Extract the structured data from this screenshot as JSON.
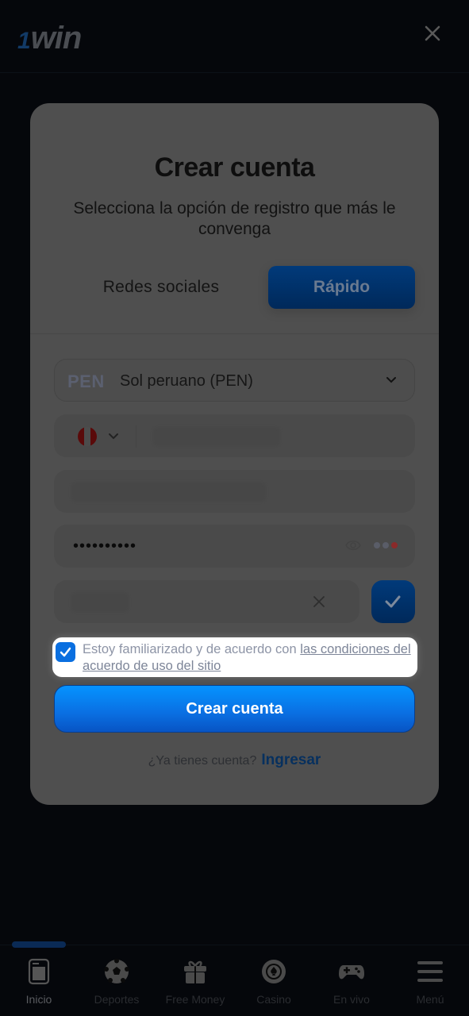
{
  "header": {
    "logo_one": "1",
    "logo_text": "win",
    "close_icon": "close-icon"
  },
  "modal": {
    "title": "Crear cuenta",
    "subtitle": "Selecciona la opción de registro que más le convenga",
    "tabs": [
      {
        "label": "Redes sociales",
        "active": false
      },
      {
        "label": "Rápido",
        "active": true
      }
    ],
    "currency": {
      "code": "PEN",
      "name": "Sol peruano (PEN)"
    },
    "phone": {
      "country_flag": "peru-flag",
      "value_obscured": true
    },
    "email": {
      "value_obscured": true
    },
    "password": {
      "masked_value": "••••••••••",
      "strength": {
        "level": 1,
        "max": 3
      }
    },
    "promo": {
      "value_obscured": true
    },
    "terms": {
      "checked": true,
      "text_prefix": "Estoy familiarizado y de acuerdo con ",
      "link_text": "las condiciones del acuerdo de uso del sitio"
    },
    "submit_label": "Crear cuenta",
    "login_prompt": "¿Ya tienes cuenta?",
    "login_link": "Ingresar"
  },
  "colors": {
    "accent": "#0a6fe0",
    "overlay_bg": "#05070b",
    "modal_bg_dimmed": "#4f4f4f"
  },
  "bottom_nav": {
    "items": [
      {
        "label": "Inicio",
        "icon": "home-icon",
        "active": true
      },
      {
        "label": "Deportes",
        "icon": "soccer-ball-icon",
        "active": false
      },
      {
        "label": "Free Money",
        "icon": "gift-icon",
        "active": false
      },
      {
        "label": "Casino",
        "icon": "casino-chip-icon",
        "active": false
      },
      {
        "label": "En vivo",
        "icon": "gamepad-icon",
        "active": false
      },
      {
        "label": "Menú",
        "icon": "menu-icon",
        "active": false
      }
    ]
  }
}
